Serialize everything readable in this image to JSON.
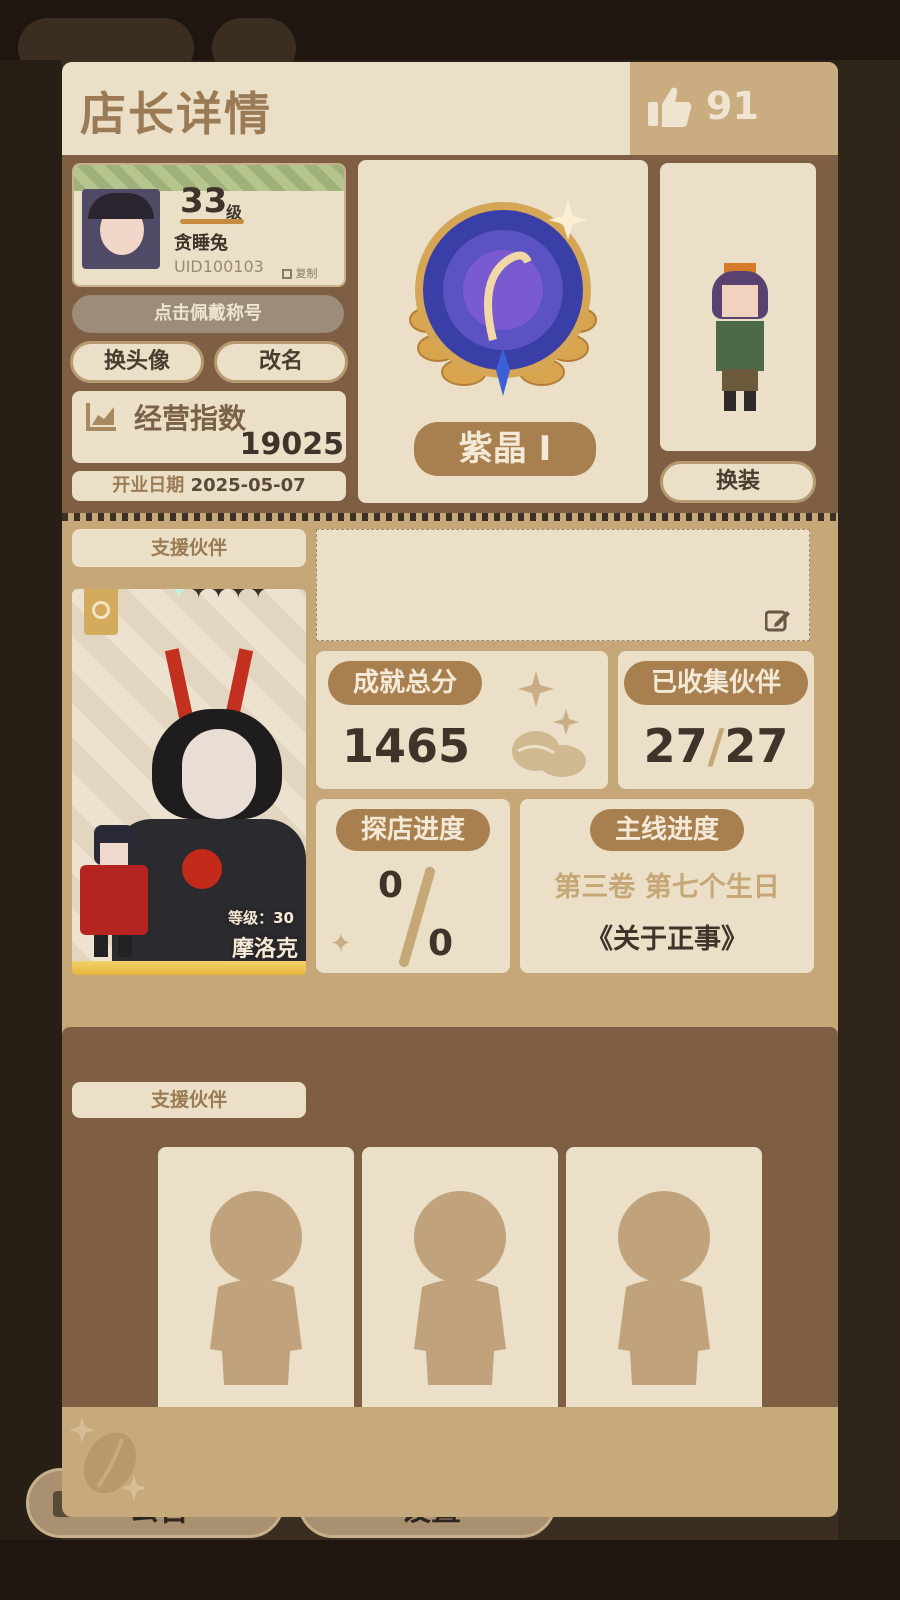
{
  "background": {
    "bottom_buttons": [
      {
        "label": "公告",
        "icon": "briefcase-icon"
      },
      {
        "label": "设置",
        "icon": "gear-icon"
      }
    ]
  },
  "header": {
    "title": "店长详情",
    "likes": "91",
    "likes_icon": "thumbs-up-icon"
  },
  "profile": {
    "level": "33",
    "level_suffix": "级",
    "name": "贪睡兔",
    "uid": "UID100103",
    "copy_label": "复制",
    "title_button": "点击佩戴称号",
    "change_avatar": "换头像",
    "rename": "改名",
    "business_index_label": "经营指数",
    "business_index_value": "19025",
    "open_date_label": "开业日期",
    "open_date_value": "2025-05-07"
  },
  "rank": {
    "name": "紫晶 Ⅰ"
  },
  "outfit": {
    "change_outfit": "换装"
  },
  "support": {
    "label": "支援伙伴",
    "partner_level": "等级：30",
    "partner_name": "摩洛克",
    "stars": 5
  },
  "stats": {
    "achievement_label": "成就总分",
    "achievement_value": "1465",
    "collected_label": "已收集伙伴",
    "collected_have": "27",
    "collected_sep": "/",
    "collected_total": "27",
    "explore_label": "探店进度",
    "explore_have": "0",
    "explore_total": "0",
    "story_label": "主线进度",
    "story_chapter": "第三卷 第七个生日",
    "story_title": "《关于正事》"
  },
  "support2": {
    "label": "支援伙伴",
    "slots": 3
  },
  "colors": {
    "cream": "#ebdfc7",
    "tan": "#c6a878",
    "brown": "#7f5f44",
    "accent": "#a88050"
  }
}
